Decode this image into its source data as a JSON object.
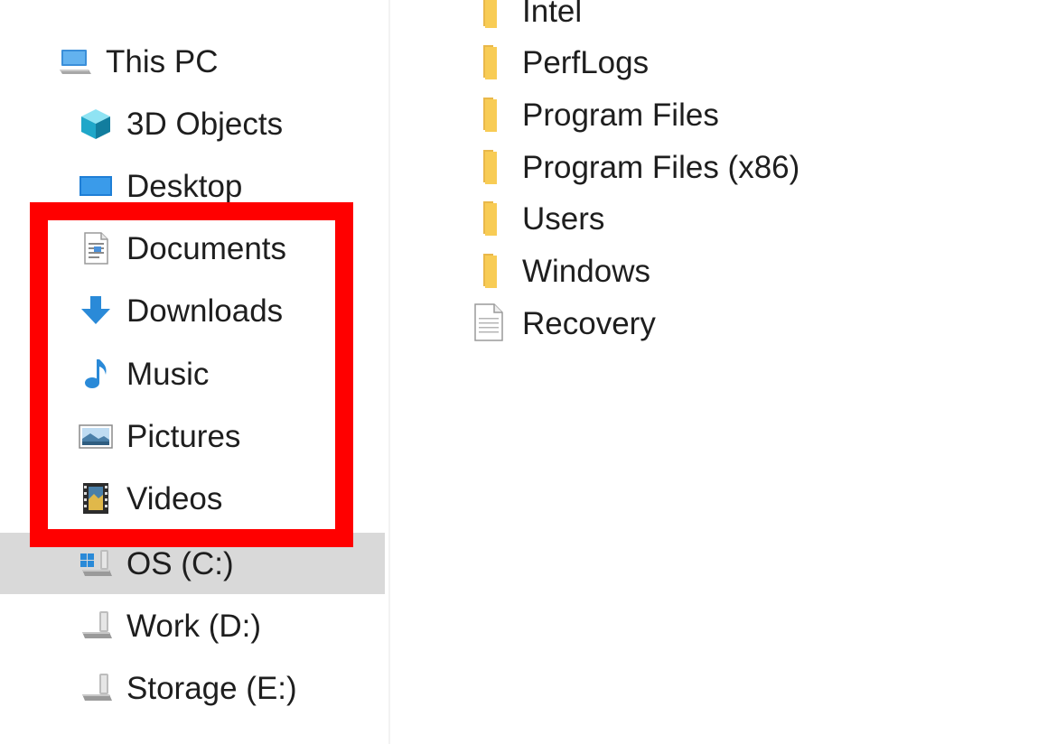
{
  "navigation": {
    "this_pc": "This PC",
    "items": [
      {
        "label": "3D Objects",
        "icon": "3d-objects-icon"
      },
      {
        "label": "Desktop",
        "icon": "desktop-icon"
      },
      {
        "label": "Documents",
        "icon": "documents-icon"
      },
      {
        "label": "Downloads",
        "icon": "downloads-icon"
      },
      {
        "label": "Music",
        "icon": "music-icon"
      },
      {
        "label": "Pictures",
        "icon": "pictures-icon"
      },
      {
        "label": "Videos",
        "icon": "videos-icon"
      },
      {
        "label": "OS (C:)",
        "icon": "windows-drive-icon",
        "selected": true
      },
      {
        "label": "Work (D:)",
        "icon": "drive-icon"
      },
      {
        "label": "Storage (E:)",
        "icon": "drive-icon"
      }
    ]
  },
  "content": {
    "files": [
      {
        "name": "Intel",
        "type": "folder"
      },
      {
        "name": "PerfLogs",
        "type": "folder"
      },
      {
        "name": "Program Files",
        "type": "folder"
      },
      {
        "name": "Program Files (x86)",
        "type": "folder"
      },
      {
        "name": "Users",
        "type": "folder"
      },
      {
        "name": "Windows",
        "type": "folder"
      },
      {
        "name": "Recovery",
        "type": "file"
      }
    ]
  },
  "colors": {
    "highlight": "#ff0000",
    "selected_background": "#d9d9d9",
    "folder": "#f8c94a",
    "accent_blue": "#2a8ad8"
  }
}
